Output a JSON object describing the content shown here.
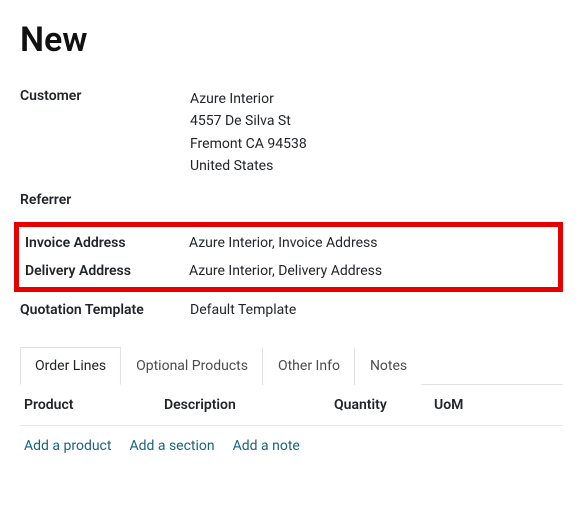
{
  "title": "New",
  "fields": {
    "customer_label": "Customer",
    "customer_name": "Azure Interior",
    "customer_street": "4557 De Silva St",
    "customer_city_line": "Fremont CA 94538",
    "customer_country": "United States",
    "referrer_label": "Referrer",
    "referrer_value": "",
    "invoice_address_label": "Invoice Address",
    "invoice_address_value": "Azure Interior, Invoice Address",
    "delivery_address_label": "Delivery Address",
    "delivery_address_value": "Azure Interior, Delivery Address",
    "quotation_template_label": "Quotation Template",
    "quotation_template_value": "Default Template"
  },
  "tabs": {
    "order_lines": "Order Lines",
    "optional_products": "Optional Products",
    "other_info": "Other Info",
    "notes": "Notes"
  },
  "columns": {
    "product": "Product",
    "description": "Description",
    "quantity": "Quantity",
    "uom": "UoM"
  },
  "actions": {
    "add_product": "Add a product",
    "add_section": "Add a section",
    "add_note": "Add a note"
  }
}
